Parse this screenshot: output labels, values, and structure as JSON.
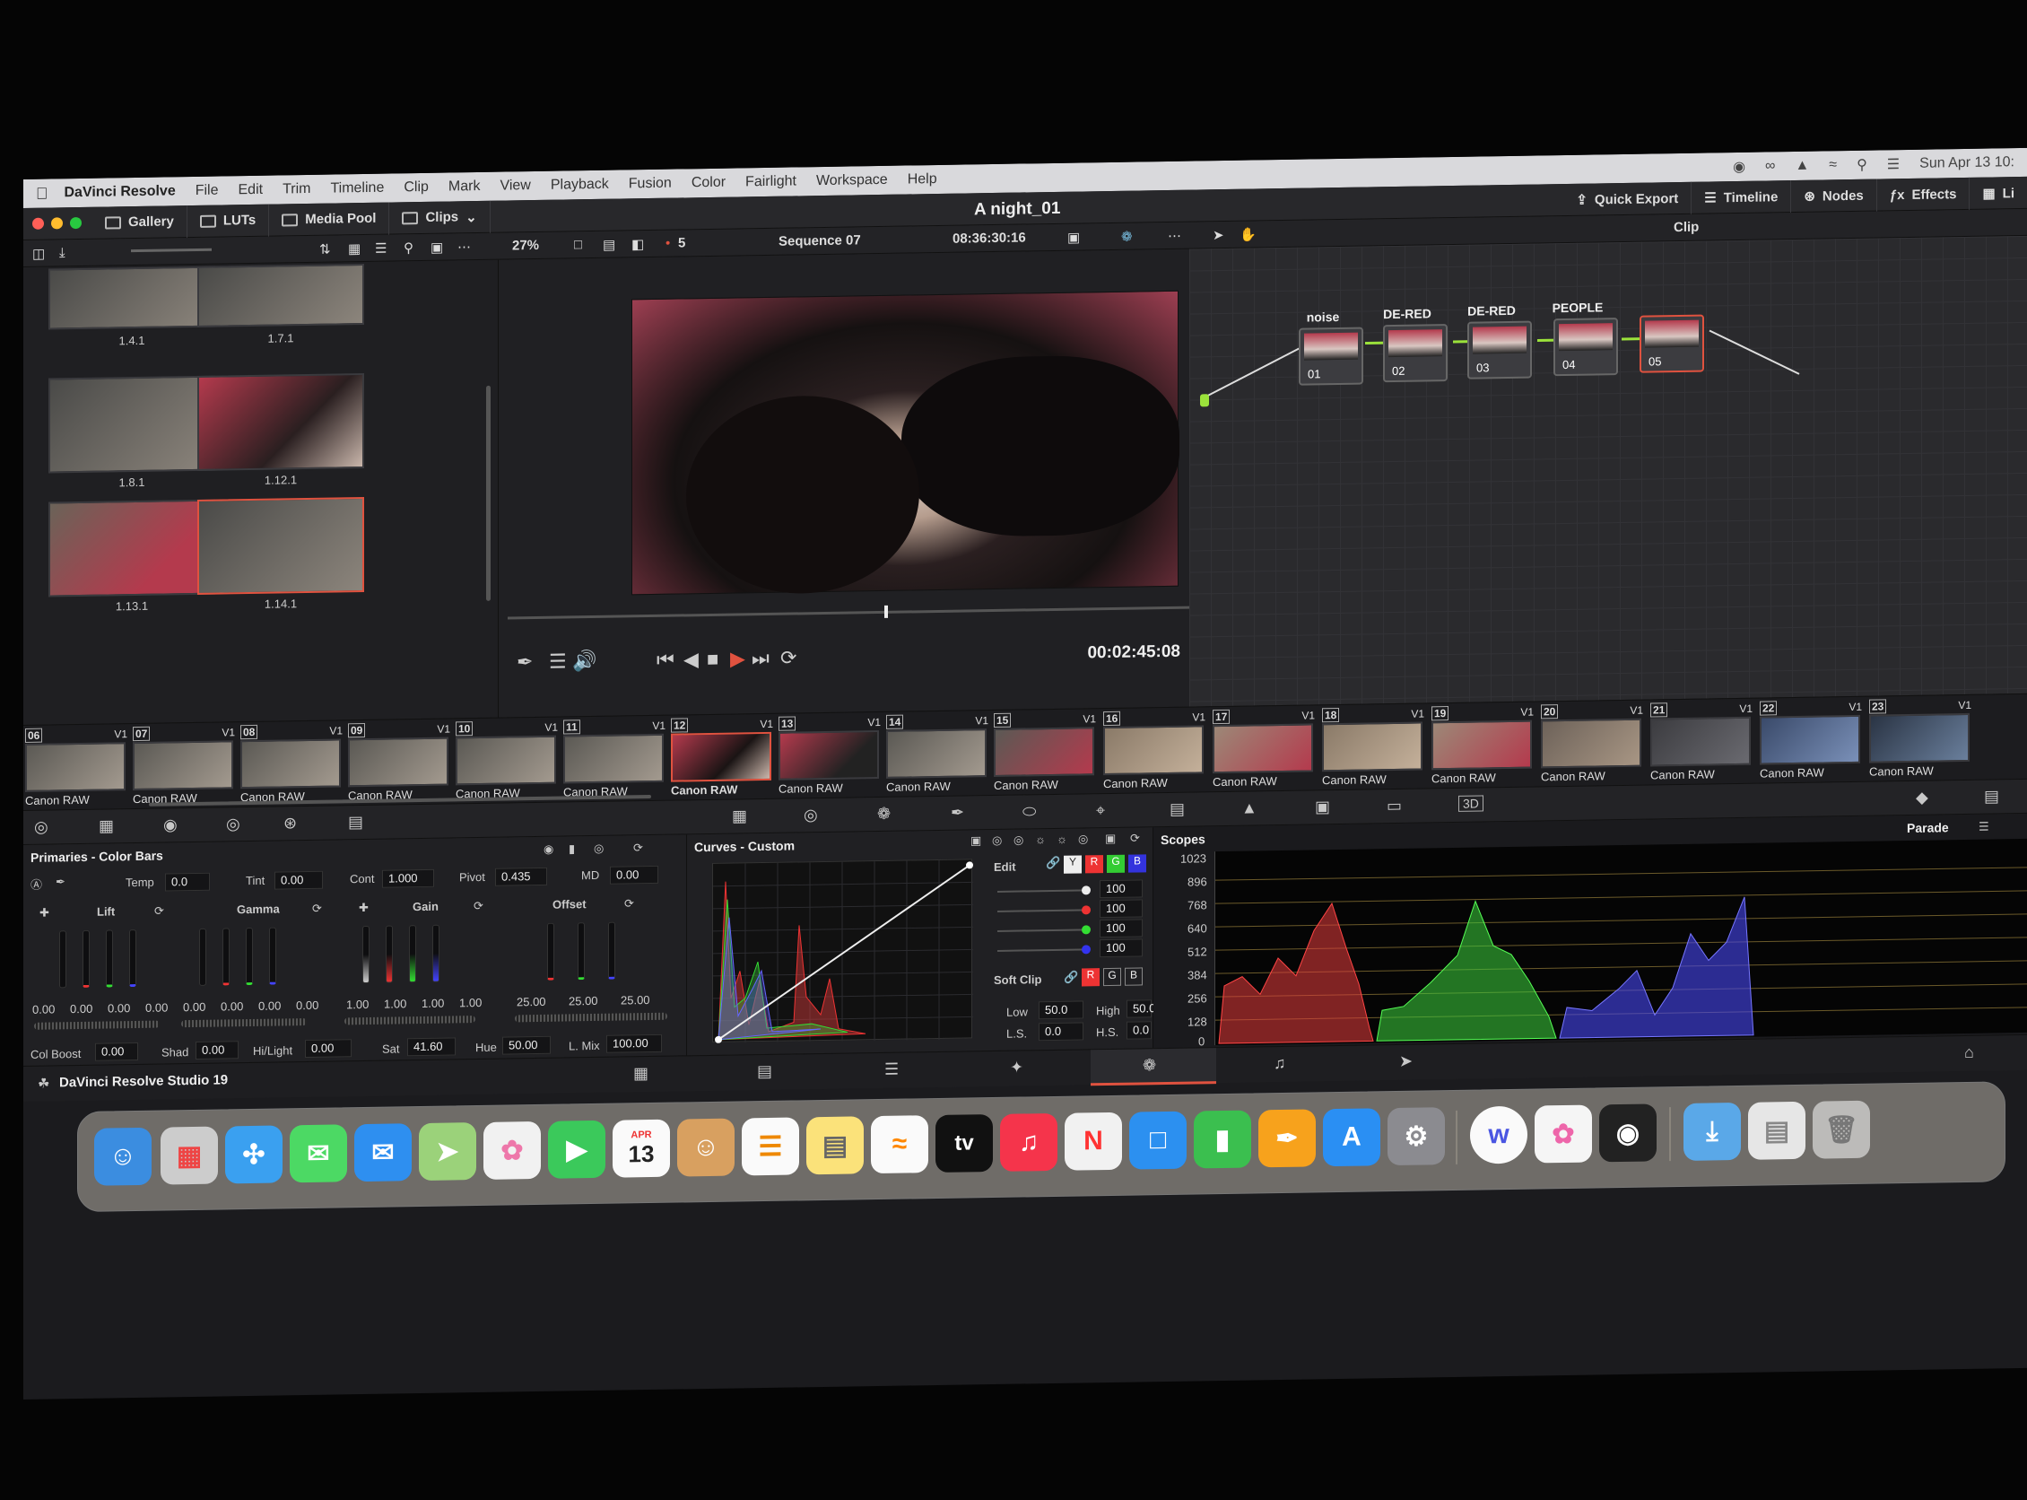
{
  "menubar": {
    "app": "DaVinci Resolve",
    "items": [
      "File",
      "Edit",
      "Trim",
      "Timeline",
      "Clip",
      "Mark",
      "View",
      "Playback",
      "Fusion",
      "Color",
      "Fairlight",
      "Workspace",
      "Help"
    ],
    "datetime": "Sun Apr 13  10:"
  },
  "titlebar": {
    "gallery": "Gallery",
    "luts": "LUTs",
    "media_pool": "Media Pool",
    "clips": "Clips",
    "project": "A night_01",
    "quick_export": "Quick Export",
    "timeline": "Timeline",
    "nodes": "Nodes",
    "effects": "Effects",
    "lightbox": "Li"
  },
  "toolbar": {
    "zoom": "27%",
    "marker_count": "5",
    "sequence": "Sequence 07",
    "timecode": "08:36:30:16",
    "clip_mode": "Clip"
  },
  "media_pool": {
    "thumbs": [
      "1.4.1",
      "1.7.1",
      "1.8.1",
      "1.12.1",
      "1.13.1",
      "1.14.1"
    ]
  },
  "viewer": {
    "timecode": "00:02:45:08"
  },
  "nodes": [
    {
      "label": "noise",
      "num": "01"
    },
    {
      "label": "DE-RED",
      "num": "02"
    },
    {
      "label": "DE-RED",
      "num": "03"
    },
    {
      "label": "PEOPLE",
      "num": "04"
    },
    {
      "label": "",
      "num": "05"
    }
  ],
  "clips": [
    {
      "num": "06",
      "track": "V1",
      "codec": "Canon RAW"
    },
    {
      "num": "07",
      "track": "V1",
      "codec": "Canon RAW"
    },
    {
      "num": "08",
      "track": "V1",
      "codec": "Canon RAW"
    },
    {
      "num": "09",
      "track": "V1",
      "codec": "Canon RAW"
    },
    {
      "num": "10",
      "track": "V1",
      "codec": "Canon RAW"
    },
    {
      "num": "11",
      "track": "V1",
      "codec": "Canon RAW"
    },
    {
      "num": "12",
      "track": "V1",
      "codec": "Canon RAW"
    },
    {
      "num": "13",
      "track": "V1",
      "codec": "Canon RAW"
    },
    {
      "num": "14",
      "track": "V1",
      "codec": "Canon RAW"
    },
    {
      "num": "15",
      "track": "V1",
      "codec": "Canon RAW"
    },
    {
      "num": "16",
      "track": "V1",
      "codec": "Canon RAW"
    },
    {
      "num": "17",
      "track": "V1",
      "codec": "Canon RAW"
    },
    {
      "num": "18",
      "track": "V1",
      "codec": "Canon RAW"
    },
    {
      "num": "19",
      "track": "V1",
      "codec": "Canon RAW"
    },
    {
      "num": "20",
      "track": "V1",
      "codec": "Canon RAW"
    },
    {
      "num": "21",
      "track": "V1",
      "codec": "Canon RAW"
    },
    {
      "num": "22",
      "track": "V1",
      "codec": "Canon RAW"
    },
    {
      "num": "23",
      "track": "V1",
      "codec": "Canon RAW"
    }
  ],
  "primaries": {
    "title": "Primaries - Color Bars",
    "temp_label": "Temp",
    "temp": "0.0",
    "tint_label": "Tint",
    "tint": "0.00",
    "cont_label": "Cont",
    "cont": "1.000",
    "pivot_label": "Pivot",
    "pivot": "0.435",
    "md_label": "MD",
    "md": "0.00",
    "lift_label": "Lift",
    "lift": [
      "0.00",
      "0.00",
      "0.00",
      "0.00"
    ],
    "gamma_label": "Gamma",
    "gamma": [
      "0.00",
      "0.00",
      "0.00",
      "0.00"
    ],
    "gain_label": "Gain",
    "gain": [
      "1.00",
      "1.00",
      "1.00",
      "1.00"
    ],
    "offset_label": "Offset",
    "offset": [
      "25.00",
      "25.00",
      "25.00"
    ],
    "colboost_label": "Col Boost",
    "colboost": "0.00",
    "shad_label": "Shad",
    "shad": "0.00",
    "hilight_label": "Hi/Light",
    "hilight": "0.00",
    "sat_label": "Sat",
    "sat": "41.60",
    "hue_label": "Hue",
    "hue": "50.00",
    "lmix_label": "L. Mix",
    "lmix": "100.00"
  },
  "curves": {
    "title": "Curves - Custom",
    "edit_label": "Edit",
    "channels": [
      "Y",
      "R",
      "G",
      "B"
    ],
    "intensities": [
      "100",
      "100",
      "100",
      "100"
    ],
    "softclip_label": "Soft Clip",
    "low_label": "Low",
    "low": "50.0",
    "high_label": "High",
    "high": "50.0",
    "ls_label": "L.S.",
    "ls": "0.0",
    "hs_label": "H.S.",
    "hs": "0.0"
  },
  "scopes": {
    "title": "Scopes",
    "mode": "Parade",
    "ticks": [
      "1023",
      "896",
      "768",
      "640",
      "512",
      "384",
      "256",
      "128",
      "0"
    ]
  },
  "status": {
    "brand": "DaVinci Resolve Studio 19"
  },
  "dock": {
    "calendar_month": "APR",
    "calendar_day": "13",
    "tv_label": "tv"
  }
}
